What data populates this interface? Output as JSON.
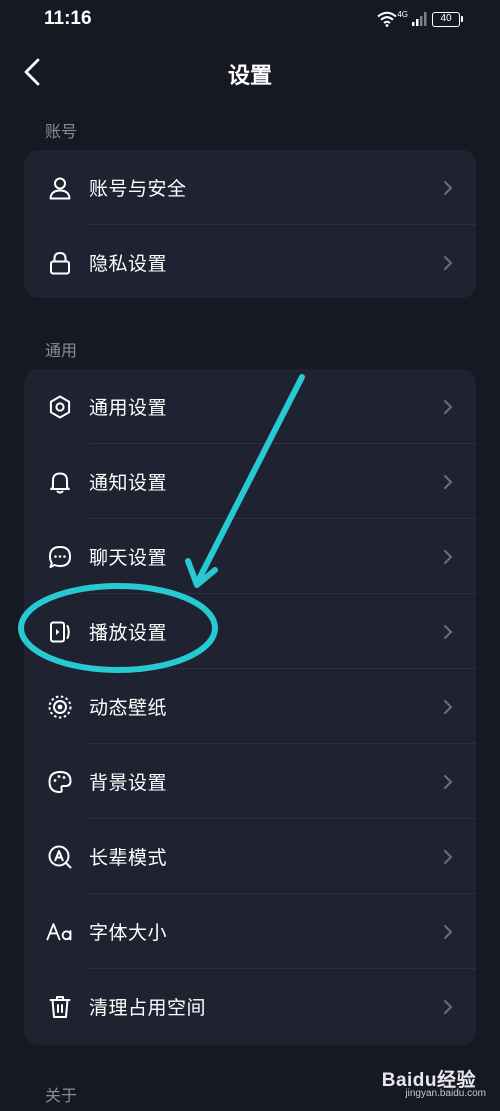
{
  "status_bar": {
    "time": "11:16",
    "network": "4G",
    "battery": "40",
    "icons": [
      "wifi-icon",
      "signal-icon",
      "battery-icon"
    ]
  },
  "header": {
    "title": "设置",
    "back_icon": "back-chevron-icon"
  },
  "sections": [
    {
      "label": "账号",
      "items": [
        {
          "label": "账号与安全",
          "icon": "user-icon"
        },
        {
          "label": "隐私设置",
          "icon": "lock-icon"
        }
      ]
    },
    {
      "label": "通用",
      "items": [
        {
          "label": "通用设置",
          "icon": "gear-icon"
        },
        {
          "label": "通知设置",
          "icon": "bell-icon"
        },
        {
          "label": "聊天设置",
          "icon": "chat-icon"
        },
        {
          "label": "播放设置",
          "icon": "play-device-icon"
        },
        {
          "label": "动态壁纸",
          "icon": "live-wallpaper-icon"
        },
        {
          "label": "背景设置",
          "icon": "palette-icon"
        },
        {
          "label": "长辈模式",
          "icon": "elder-mode-icon"
        },
        {
          "label": "字体大小",
          "icon": "font-size-icon"
        },
        {
          "label": "清理占用空间",
          "icon": "trash-icon"
        }
      ]
    },
    {
      "label": "关于",
      "items": []
    }
  ],
  "annotation": {
    "color": "#27c9d3",
    "highlighted_item": "播放设置"
  },
  "watermark": {
    "brand": "Baidu经验",
    "url": "jingyan.baidu.com"
  },
  "colors": {
    "background": "#161822",
    "card": "#1f2230",
    "text": "#ffffff",
    "secondary_text": "#8a8c95",
    "chevron": "#6c6f7a"
  }
}
